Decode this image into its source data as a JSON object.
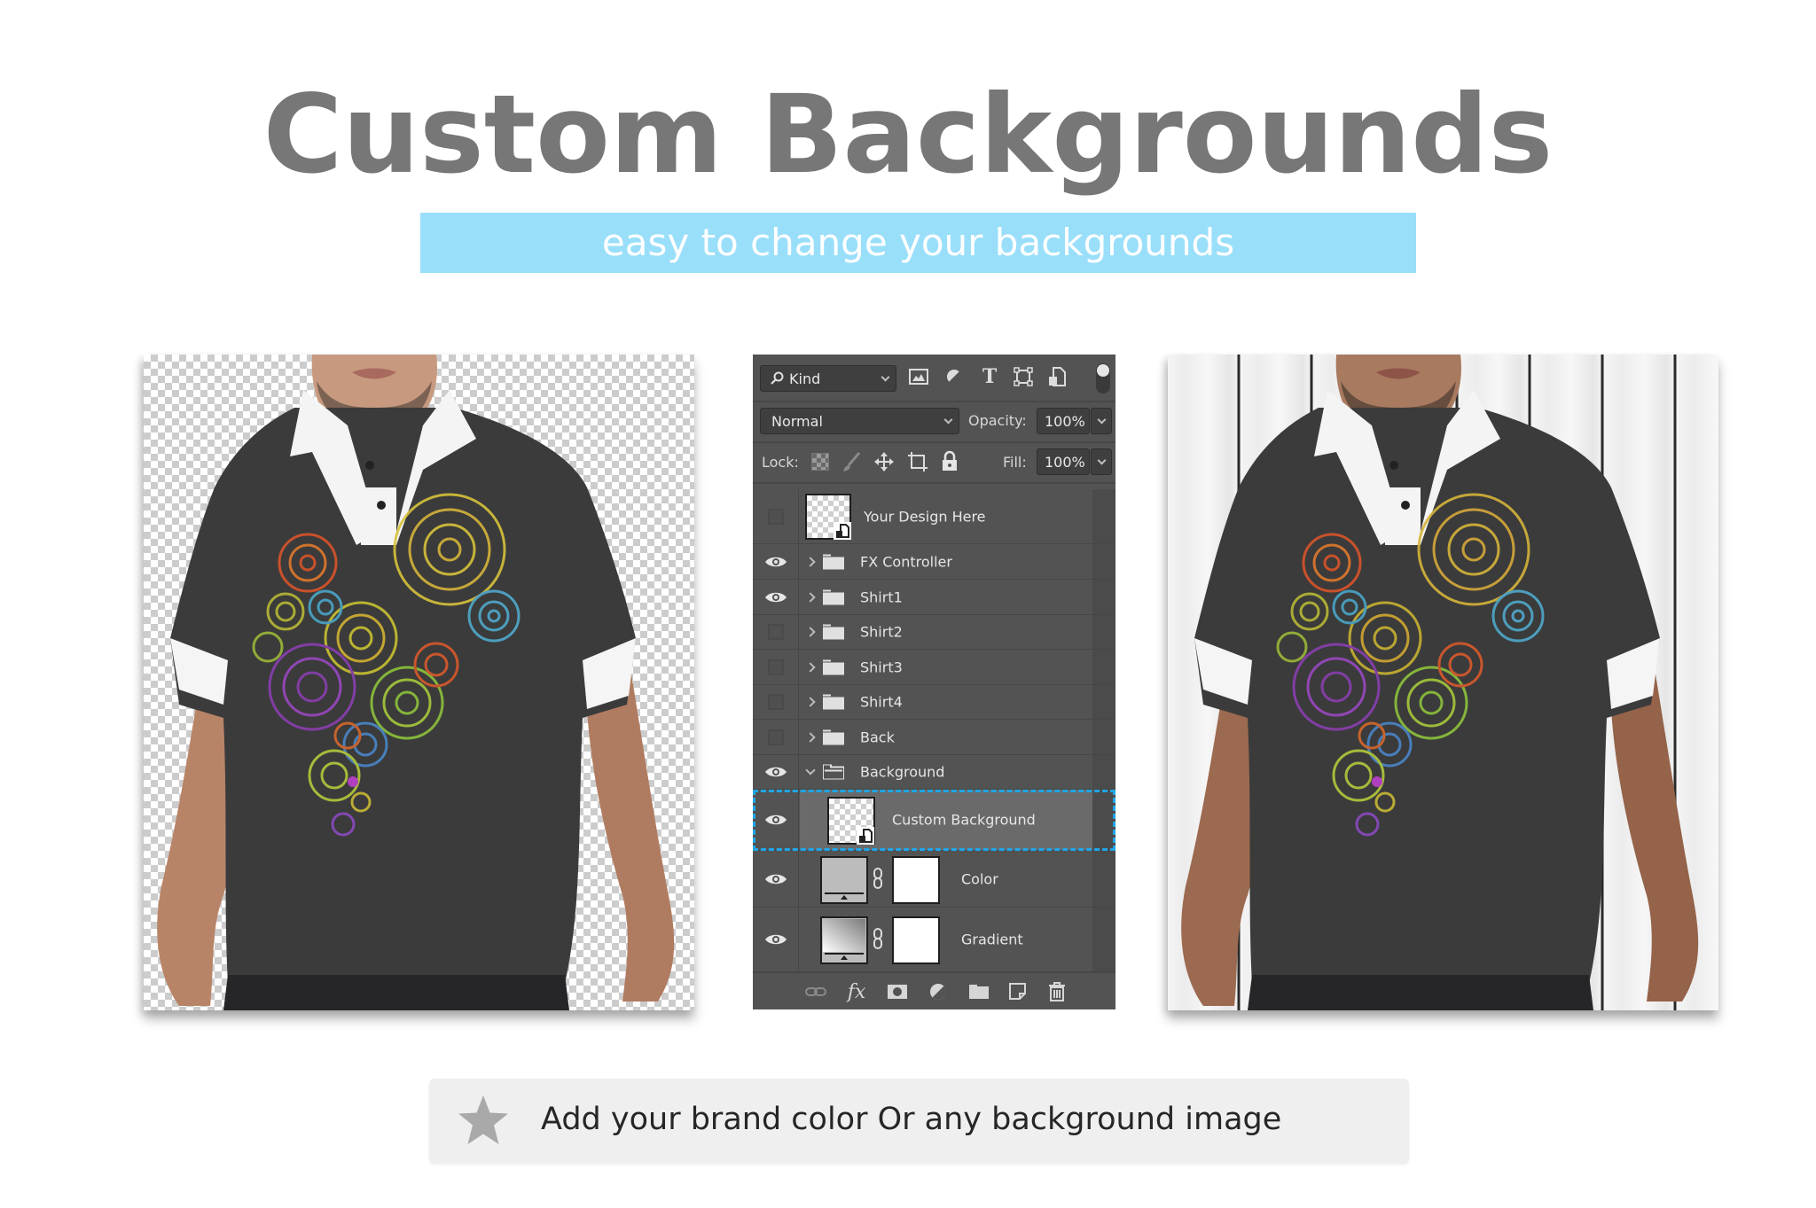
{
  "header": {
    "title": "Custom Backgrounds",
    "subtitle": "easy to change your backgrounds",
    "subtitle_bg": "#9ADFFA",
    "title_color": "#777777"
  },
  "previews": {
    "left": {
      "label": "transparent-background-mockup",
      "background": "checkerboard"
    },
    "right": {
      "label": "wood-background-mockup",
      "background": "white wood planks"
    }
  },
  "layers_panel": {
    "filter": {
      "icon": "search-icon",
      "value": "Kind"
    },
    "filter_icons": [
      "image-filter-icon",
      "adjustment-filter-icon",
      "type-filter-icon",
      "shape-filter-icon",
      "smart-object-filter-icon",
      "filter-toggle"
    ],
    "blend_mode": "Normal",
    "opacity_label": "Opacity:",
    "opacity_value": "100%",
    "lock_label": "Lock:",
    "lock_icons": [
      "lock-transparent-icon",
      "lock-paint-icon",
      "lock-position-icon",
      "lock-artboard-icon",
      "lock-all-icon"
    ],
    "fill_label": "Fill:",
    "fill_value": "100%",
    "layers": [
      {
        "name": "Your Design Here",
        "type": "smart-object",
        "visible": false
      },
      {
        "name": "FX Controller",
        "type": "group",
        "visible": true,
        "expanded": false
      },
      {
        "name": "Shirt1",
        "type": "group",
        "visible": true,
        "expanded": false
      },
      {
        "name": "Shirt2",
        "type": "group",
        "visible": false,
        "expanded": false
      },
      {
        "name": "Shirt3",
        "type": "group",
        "visible": false,
        "expanded": false
      },
      {
        "name": "Shirt4",
        "type": "group",
        "visible": false,
        "expanded": false
      },
      {
        "name": "Back",
        "type": "group",
        "visible": false,
        "expanded": false
      },
      {
        "name": "Background",
        "type": "group",
        "visible": true,
        "expanded": true
      },
      {
        "name": "Custom Background",
        "type": "smart-object",
        "visible": true,
        "selected": true
      },
      {
        "name": "Color",
        "type": "adjustment",
        "visible": true
      },
      {
        "name": "Gradient",
        "type": "adjustment",
        "visible": true
      }
    ],
    "footer_icons": [
      "link-layers-icon",
      "fx-icon",
      "add-mask-icon",
      "new-adjustment-icon",
      "new-group-icon",
      "new-layer-icon",
      "delete-icon"
    ],
    "selection_color": "#1EA6E8"
  },
  "callout": {
    "icon": "star-icon",
    "text": "Add your brand color Or any background image"
  }
}
